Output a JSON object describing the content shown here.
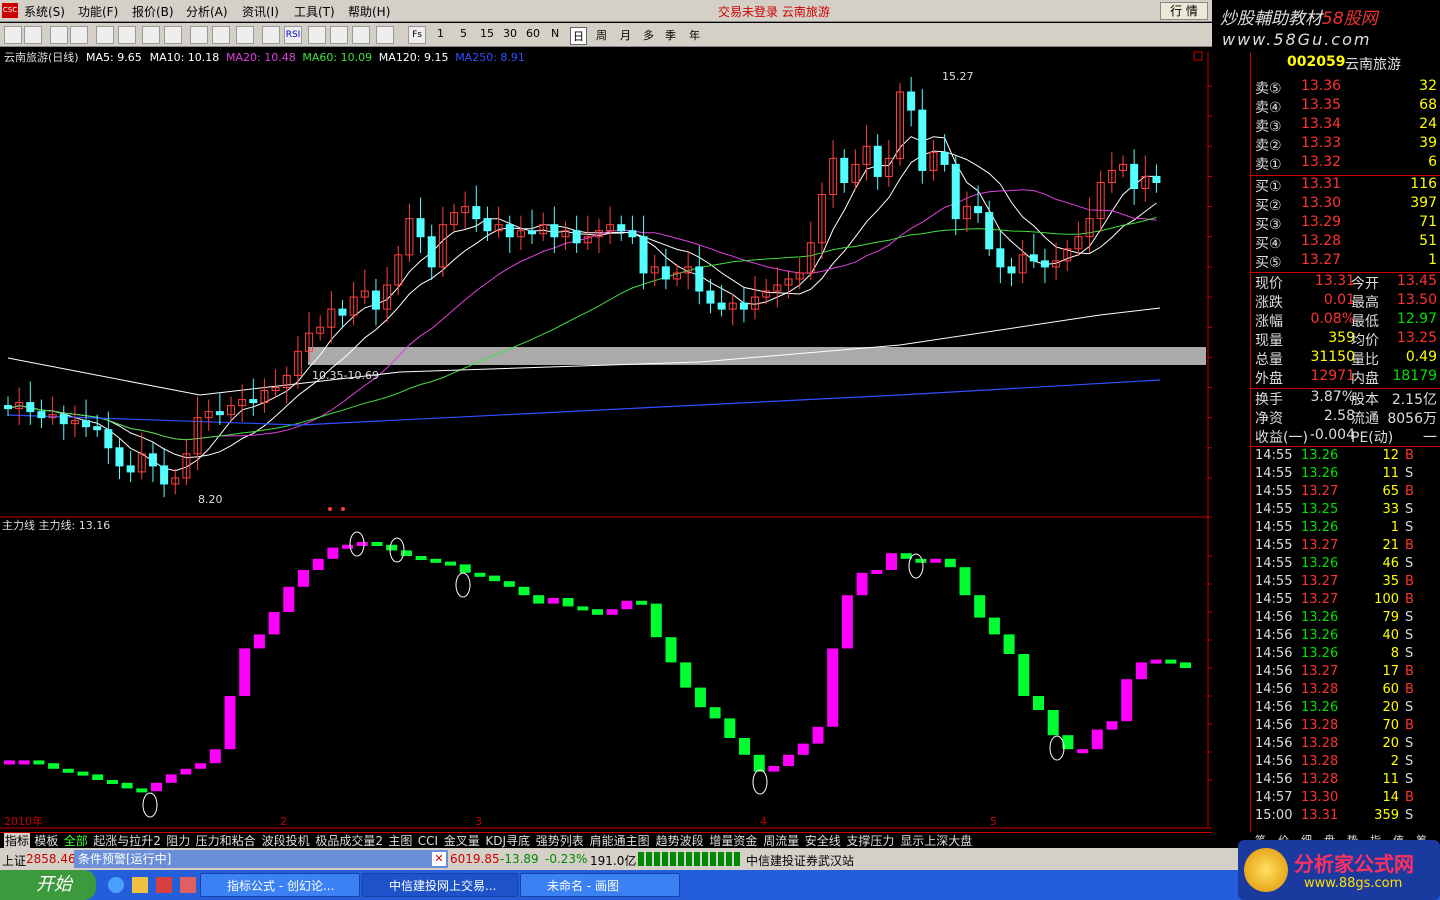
{
  "menu": {
    "items": [
      "系统(S)",
      "功能(F)",
      "报价(B)",
      "分析(A)",
      "资讯(I)",
      "工具(T)",
      "帮助(H)"
    ],
    "status": "交易未登录  云南旅游",
    "quote_btn": "行 情",
    "logo": "CSC"
  },
  "toolbar": {
    "periods": [
      "1",
      "5",
      "15",
      "30",
      "60",
      "N",
      "日",
      "周",
      "月",
      "多",
      "季",
      "年"
    ],
    "icons": [
      "Fs",
      "RSI"
    ]
  },
  "brand": {
    "line1_a": "炒股輔助教材",
    "line1_b": "58股网",
    "line2": "www.58Gu.com"
  },
  "title": {
    "name": "云南旅游(日线)",
    "ma": [
      {
        "label": "MA5: 9.65",
        "color": "#ffffff"
      },
      {
        "label": "MA10: 10.18",
        "color": "#ffffff"
      },
      {
        "label": "MA20: 10.48",
        "color": "#e040e0"
      },
      {
        "label": "MA60: 10.09",
        "color": "#40e040"
      },
      {
        "label": "MA120: 9.15",
        "color": "#ffffff"
      },
      {
        "label": "MA250: 8.91",
        "color": "#3050ff"
      }
    ]
  },
  "annotations": {
    "high": "15.27",
    "low": "8.20",
    "band": "10.35-10.69"
  },
  "sub": {
    "title": "主力线  主力线: 13.16"
  },
  "axis_main": [
    "15.00",
    "14.50",
    "14.00",
    "13.50",
    "13.00",
    "12.50",
    "12.00",
    "11.50",
    "11.00",
    "10.50",
    "10.00",
    "9.50",
    "9.00",
    "8.50"
  ],
  "axis_sub": [
    "90.00",
    "80.00",
    "70.00",
    "60.00",
    "50.00",
    "40.00",
    "30.00",
    "20.00",
    "10.00"
  ],
  "xaxis": {
    "year": "2010年",
    "period": "日线",
    "months": [
      "2",
      "3",
      "4",
      "5"
    ]
  },
  "stock": {
    "code": "002059",
    "name": "云南旅游"
  },
  "asks": [
    {
      "l": "卖⑤",
      "p": "13.36",
      "v": "32"
    },
    {
      "l": "卖④",
      "p": "13.35",
      "v": "68"
    },
    {
      "l": "卖③",
      "p": "13.34",
      "v": "24"
    },
    {
      "l": "卖②",
      "p": "13.33",
      "v": "39"
    },
    {
      "l": "卖①",
      "p": "13.32",
      "v": "6"
    }
  ],
  "bids": [
    {
      "l": "买①",
      "p": "13.31",
      "v": "116"
    },
    {
      "l": "买②",
      "p": "13.30",
      "v": "397"
    },
    {
      "l": "买③",
      "p": "13.29",
      "v": "71"
    },
    {
      "l": "买④",
      "p": "13.28",
      "v": "51"
    },
    {
      "l": "买⑤",
      "p": "13.27",
      "v": "1"
    }
  ],
  "stats": [
    {
      "a": "现价",
      "b": "13.31",
      "bc": "red",
      "c": "今开",
      "d": "13.45",
      "dc": "red"
    },
    {
      "a": "涨跌",
      "b": "0.01",
      "bc": "red",
      "c": "最高",
      "d": "13.50",
      "dc": "red"
    },
    {
      "a": "涨幅",
      "b": "0.08%",
      "bc": "red",
      "c": "最低",
      "d": "12.97",
      "dc": "grn"
    },
    {
      "a": "现量",
      "b": "359",
      "bc": "yel",
      "c": "均价",
      "d": "13.25",
      "dc": "red"
    },
    {
      "a": "总量",
      "b": "31150",
      "bc": "yel",
      "c": "量比",
      "d": "0.49",
      "dc": "yel"
    },
    {
      "a": "外盘",
      "b": "12971",
      "bc": "red",
      "c": "内盘",
      "d": "18179",
      "dc": "grn"
    },
    {
      "a": "换手",
      "b": "3.87%",
      "bc": "w",
      "c": "股本",
      "d": "2.15亿",
      "dc": "w"
    },
    {
      "a": "净资",
      "b": "2.58",
      "bc": "w",
      "c": "流通",
      "d": "8056万",
      "dc": "w"
    },
    {
      "a": "收益(一)",
      "b": "-0.004",
      "bc": "w",
      "c": "PE(动)",
      "d": "一",
      "dc": "w"
    }
  ],
  "ticks": [
    [
      "14:55",
      "13.26",
      "12",
      "B"
    ],
    [
      "14:55",
      "13.26",
      "11",
      "S"
    ],
    [
      "14:55",
      "13.27",
      "65",
      "B"
    ],
    [
      "14:55",
      "13.25",
      "33",
      "S"
    ],
    [
      "14:55",
      "13.26",
      "1",
      "S"
    ],
    [
      "14:55",
      "13.27",
      "21",
      "B"
    ],
    [
      "14:55",
      "13.26",
      "46",
      "S"
    ],
    [
      "14:55",
      "13.27",
      "35",
      "B"
    ],
    [
      "14:55",
      "13.27",
      "100",
      "B"
    ],
    [
      "14:56",
      "13.26",
      "79",
      "S"
    ],
    [
      "14:56",
      "13.26",
      "40",
      "S"
    ],
    [
      "14:56",
      "13.26",
      "8",
      "S"
    ],
    [
      "14:56",
      "13.27",
      "17",
      "B"
    ],
    [
      "14:56",
      "13.28",
      "60",
      "B"
    ],
    [
      "14:56",
      "13.26",
      "20",
      "S"
    ],
    [
      "14:56",
      "13.28",
      "70",
      "B"
    ],
    [
      "14:56",
      "13.28",
      "20",
      "S"
    ],
    [
      "14:56",
      "13.28",
      "2",
      "S"
    ],
    [
      "14:56",
      "13.28",
      "11",
      "S"
    ],
    [
      "14:57",
      "13.30",
      "14",
      "B"
    ],
    [
      "15:00",
      "13.31",
      "359",
      "S"
    ]
  ],
  "rp_tabs": [
    "笔",
    "价",
    "细",
    "盘",
    "势",
    "指",
    "值",
    "筹"
  ],
  "tabs": [
    "指标",
    "模板",
    "全部",
    "起涨与拉升2",
    "阻力",
    "压力和粘合",
    "波段投机",
    "极品成交量2",
    "主图",
    "CCI",
    "金叉量",
    "KDJ寻底",
    "强势列表",
    "肩能通主图",
    "趋势波段",
    "增量资金",
    "周流量",
    "安全线",
    "支撑压力",
    "显示上深大盘"
  ],
  "statusbar": {
    "sh_label": "上证",
    "sh_value": "2858.46",
    "popup": "条件预警[运行中]",
    "idx_val": "6019.85",
    "idx_chg": "-13.89",
    "idx_pct": "-0.23%",
    "idx_amt": "191.0亿",
    "broker": "中信建投证券武汉站"
  },
  "taskbar": {
    "start": "开始",
    "tasks": [
      "指标公式 - 创幻论...",
      "中信建投网上交易...",
      "未命名 - 画图"
    ],
    "fxj_text": "分析家公式网",
    "fxj_url": "www.88gs.com"
  }
}
